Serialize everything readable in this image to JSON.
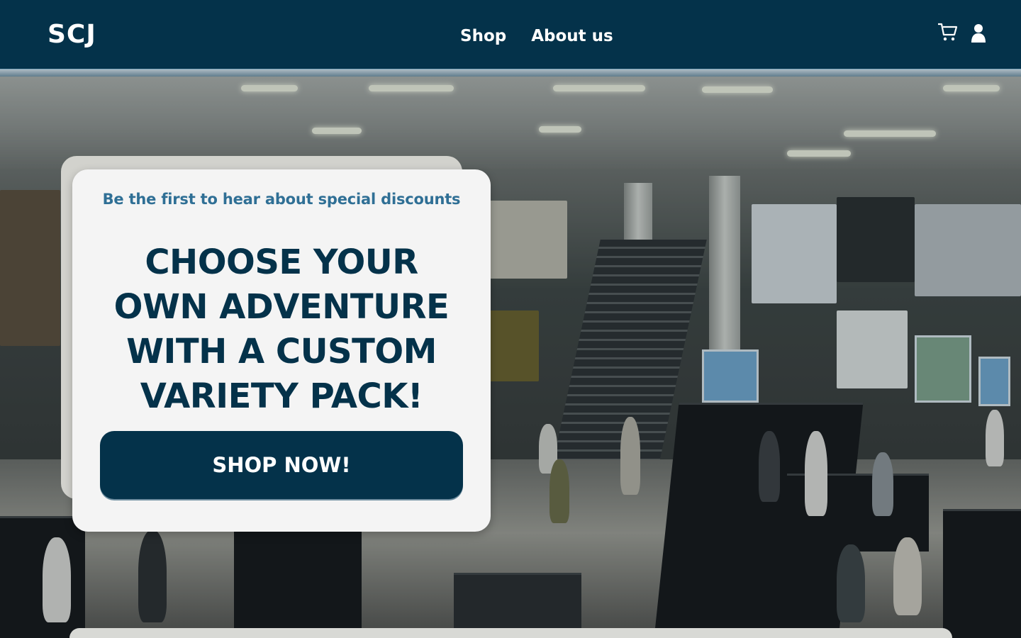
{
  "header": {
    "brand": "SCJ",
    "nav": [
      {
        "label": "Shop"
      },
      {
        "label": "About us"
      }
    ],
    "icons": [
      "cart-icon",
      "user-icon"
    ]
  },
  "hero": {
    "kicker": "Be the first to hear about special discounts",
    "headline": "CHOOSE YOUR OWN ADVENTURE WITH A CUSTOM VARIETY PACK!",
    "cta_label": "SHOP NOW!"
  },
  "colors": {
    "navy": "#04324a",
    "accent_blue": "#2f6f95",
    "card_bg": "#f4f4f4"
  }
}
